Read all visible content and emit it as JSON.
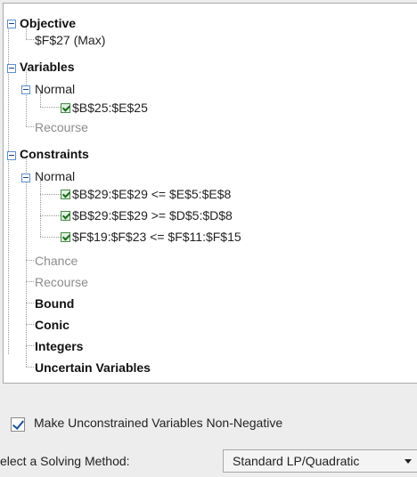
{
  "tree": {
    "objective": {
      "label": "Objective",
      "cell": "$F$27 (Max)"
    },
    "variables": {
      "label": "Variables",
      "normal": {
        "label": "Normal",
        "items": [
          "$B$25:$E$25"
        ]
      },
      "recourse": "Recourse"
    },
    "constraints": {
      "label": "Constraints",
      "normal": {
        "label": "Normal",
        "items": [
          "$B$29:$E$29 <= $E$5:$E$8",
          "$B$29:$E$29 >= $D$5:$D$8",
          "$F$19:$F$23 <= $F$11:$F$15"
        ]
      },
      "chance": "Chance",
      "recourse": "Recourse",
      "bound": "Bound",
      "conic": "Conic",
      "integers": "Integers"
    },
    "uncertain": "Uncertain Variables"
  },
  "options": {
    "non_negative": {
      "label": "Make Unconstrained Variables Non-Negative",
      "checked": true
    },
    "solving_method": {
      "label": "elect a Solving Method:",
      "value": "Standard LP/Quadratic"
    }
  }
}
